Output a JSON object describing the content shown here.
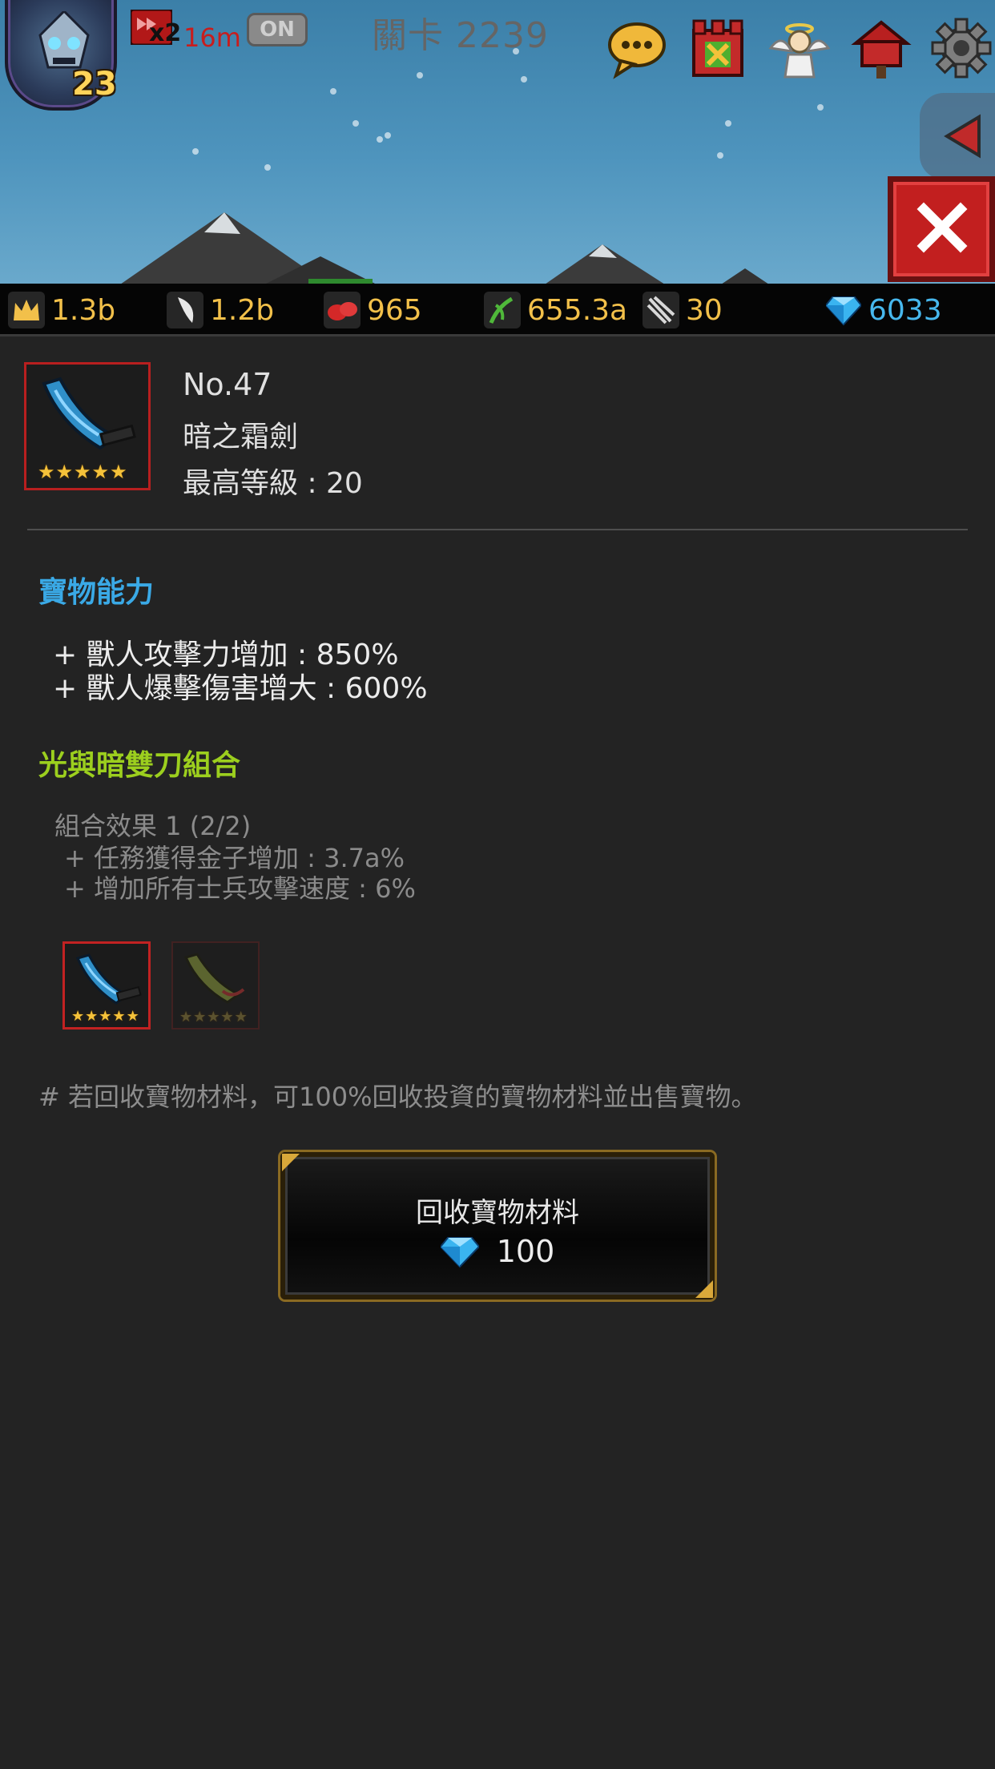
{
  "hud": {
    "player_level": "23",
    "speed_multiplier": "x2",
    "speed_time": "16m",
    "auto_toggle": "ON",
    "stage_title": "關卡 2239"
  },
  "resources": [
    {
      "icon": "crown-icon",
      "value": "1.3b"
    },
    {
      "icon": "fang-icon",
      "value": "1.2b"
    },
    {
      "icon": "meat-icon",
      "value": "965"
    },
    {
      "icon": "herb-icon",
      "value": "655.3a"
    },
    {
      "icon": "claw-icon",
      "value": "30"
    },
    {
      "icon": "gem-icon",
      "value": "6033"
    }
  ],
  "item": {
    "number": "No.47",
    "name": "暗之霜劍",
    "max_level": "最高等級 : 20",
    "stars": 5
  },
  "ability": {
    "title": "寶物能力",
    "lines": [
      "+ 獸人攻擊力增加 : 850%",
      "+ 獸人爆擊傷害增大 : 600%"
    ]
  },
  "set": {
    "title": "光與暗雙刀組合",
    "effect_header": "組合效果 1 (2/2)",
    "lines": [
      "+ 任務獲得金子增加 : 3.7a%",
      "+ 增加所有士兵攻擊速度 : 6%"
    ]
  },
  "note": "# 若回收寶物材料，可100%回收投資的寶物材料並出售寶物。",
  "recycle": {
    "label": "回收寶物材料",
    "cost": "100"
  },
  "colors": {
    "panel_bg": "#232323",
    "ability_title": "#3aa9e6",
    "set_title": "#9ccf1e",
    "gold": "#f2c04a",
    "gem_blue": "#47b8ee",
    "frame_red": "#b81f1f"
  }
}
